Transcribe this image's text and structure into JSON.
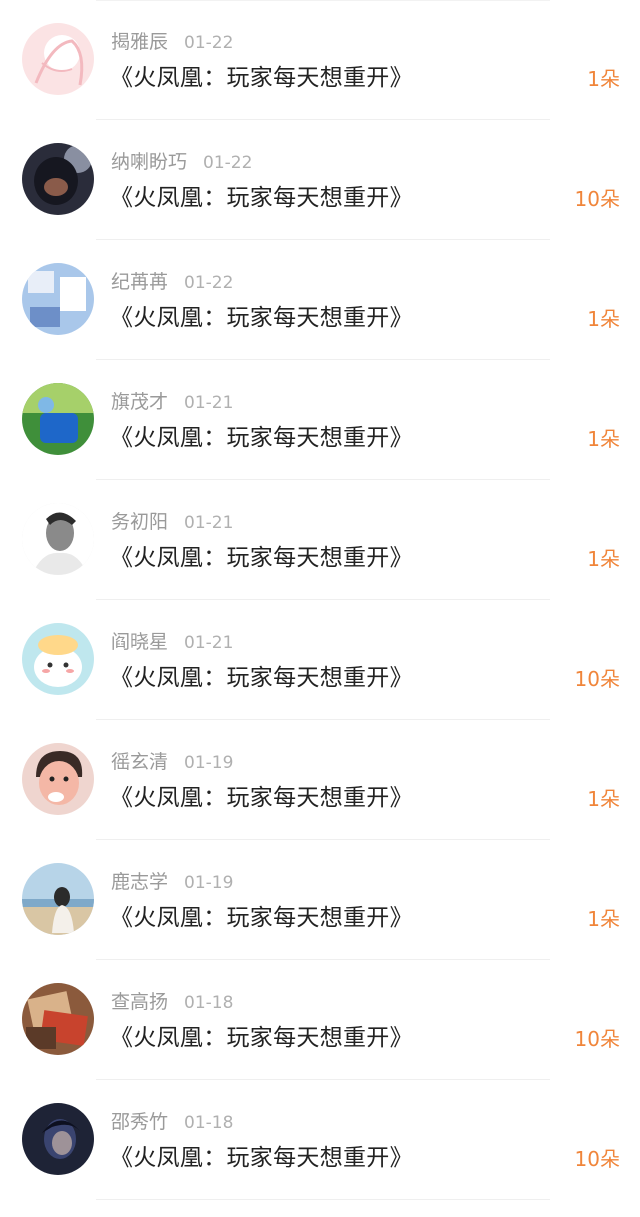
{
  "list": {
    "items": [
      {
        "name": "揭雅辰",
        "date": "01-22",
        "title": "《火凤凰：玩家每天想重开》",
        "amount": "1朵",
        "avatar": "pink-sketch-avatar",
        "colors": [
          "#fbe3e4",
          "#f3b9bf",
          "#ffffff"
        ]
      },
      {
        "name": "纳喇盼巧",
        "date": "01-22",
        "title": "《火凤凰：玩家每天想重开》",
        "amount": "10朵",
        "avatar": "gorilla-avatar",
        "colors": [
          "#2a2c3a",
          "#8a5b4a",
          "#c9d2e6"
        ]
      },
      {
        "name": "纪苒苒",
        "date": "01-22",
        "title": "《火凤凰：玩家每天想重开》",
        "amount": "1朵",
        "avatar": "anime-room-avatar",
        "colors": [
          "#a9c7ea",
          "#e8eef8",
          "#6d8fc8"
        ]
      },
      {
        "name": "旗茂才",
        "date": "01-21",
        "title": "《火凤凰：玩家每天想重开》",
        "amount": "1朵",
        "avatar": "blue-bottle-avatar",
        "colors": [
          "#3f8f3a",
          "#1e67c9",
          "#a6d06a"
        ]
      },
      {
        "name": "务初阳",
        "date": "01-21",
        "title": "《火凤凰：玩家每天想重开》",
        "amount": "1朵",
        "avatar": "bw-man-avatar",
        "colors": [
          "#e9e9e9",
          "#2c2c2c",
          "#8a8a8a"
        ]
      },
      {
        "name": "阎晓星",
        "date": "01-21",
        "title": "《火凤凰：玩家每天想重开》",
        "amount": "10朵",
        "avatar": "cartoon-bear-avatar",
        "colors": [
          "#bfe7ee",
          "#ffd88a",
          "#ffffff"
        ]
      },
      {
        "name": "徭玄清",
        "date": "01-19",
        "title": "《火凤凰：玩家每天想重开》",
        "amount": "1朵",
        "avatar": "baby-avatar",
        "colors": [
          "#efd5cf",
          "#3a2a26",
          "#f4b7a6"
        ]
      },
      {
        "name": "鹿志学",
        "date": "01-19",
        "title": "《火凤凰：玩家每天想重开》",
        "amount": "1朵",
        "avatar": "beach-girl-avatar",
        "colors": [
          "#b7d4e8",
          "#d9c6a4",
          "#2b2b2b"
        ]
      },
      {
        "name": "查高扬",
        "date": "01-18",
        "title": "《火凤凰：玩家每天想重开》",
        "amount": "10朵",
        "avatar": "notebooks-avatar",
        "colors": [
          "#8b5a3c",
          "#c8432d",
          "#d9b28a"
        ]
      },
      {
        "name": "邵秀竹",
        "date": "01-18",
        "title": "《火凤凰：玩家每天想重开》",
        "amount": "10朵",
        "avatar": "dark-portrait-avatar",
        "colors": [
          "#1e2336",
          "#3a4470",
          "#c9b3a9"
        ]
      }
    ]
  }
}
